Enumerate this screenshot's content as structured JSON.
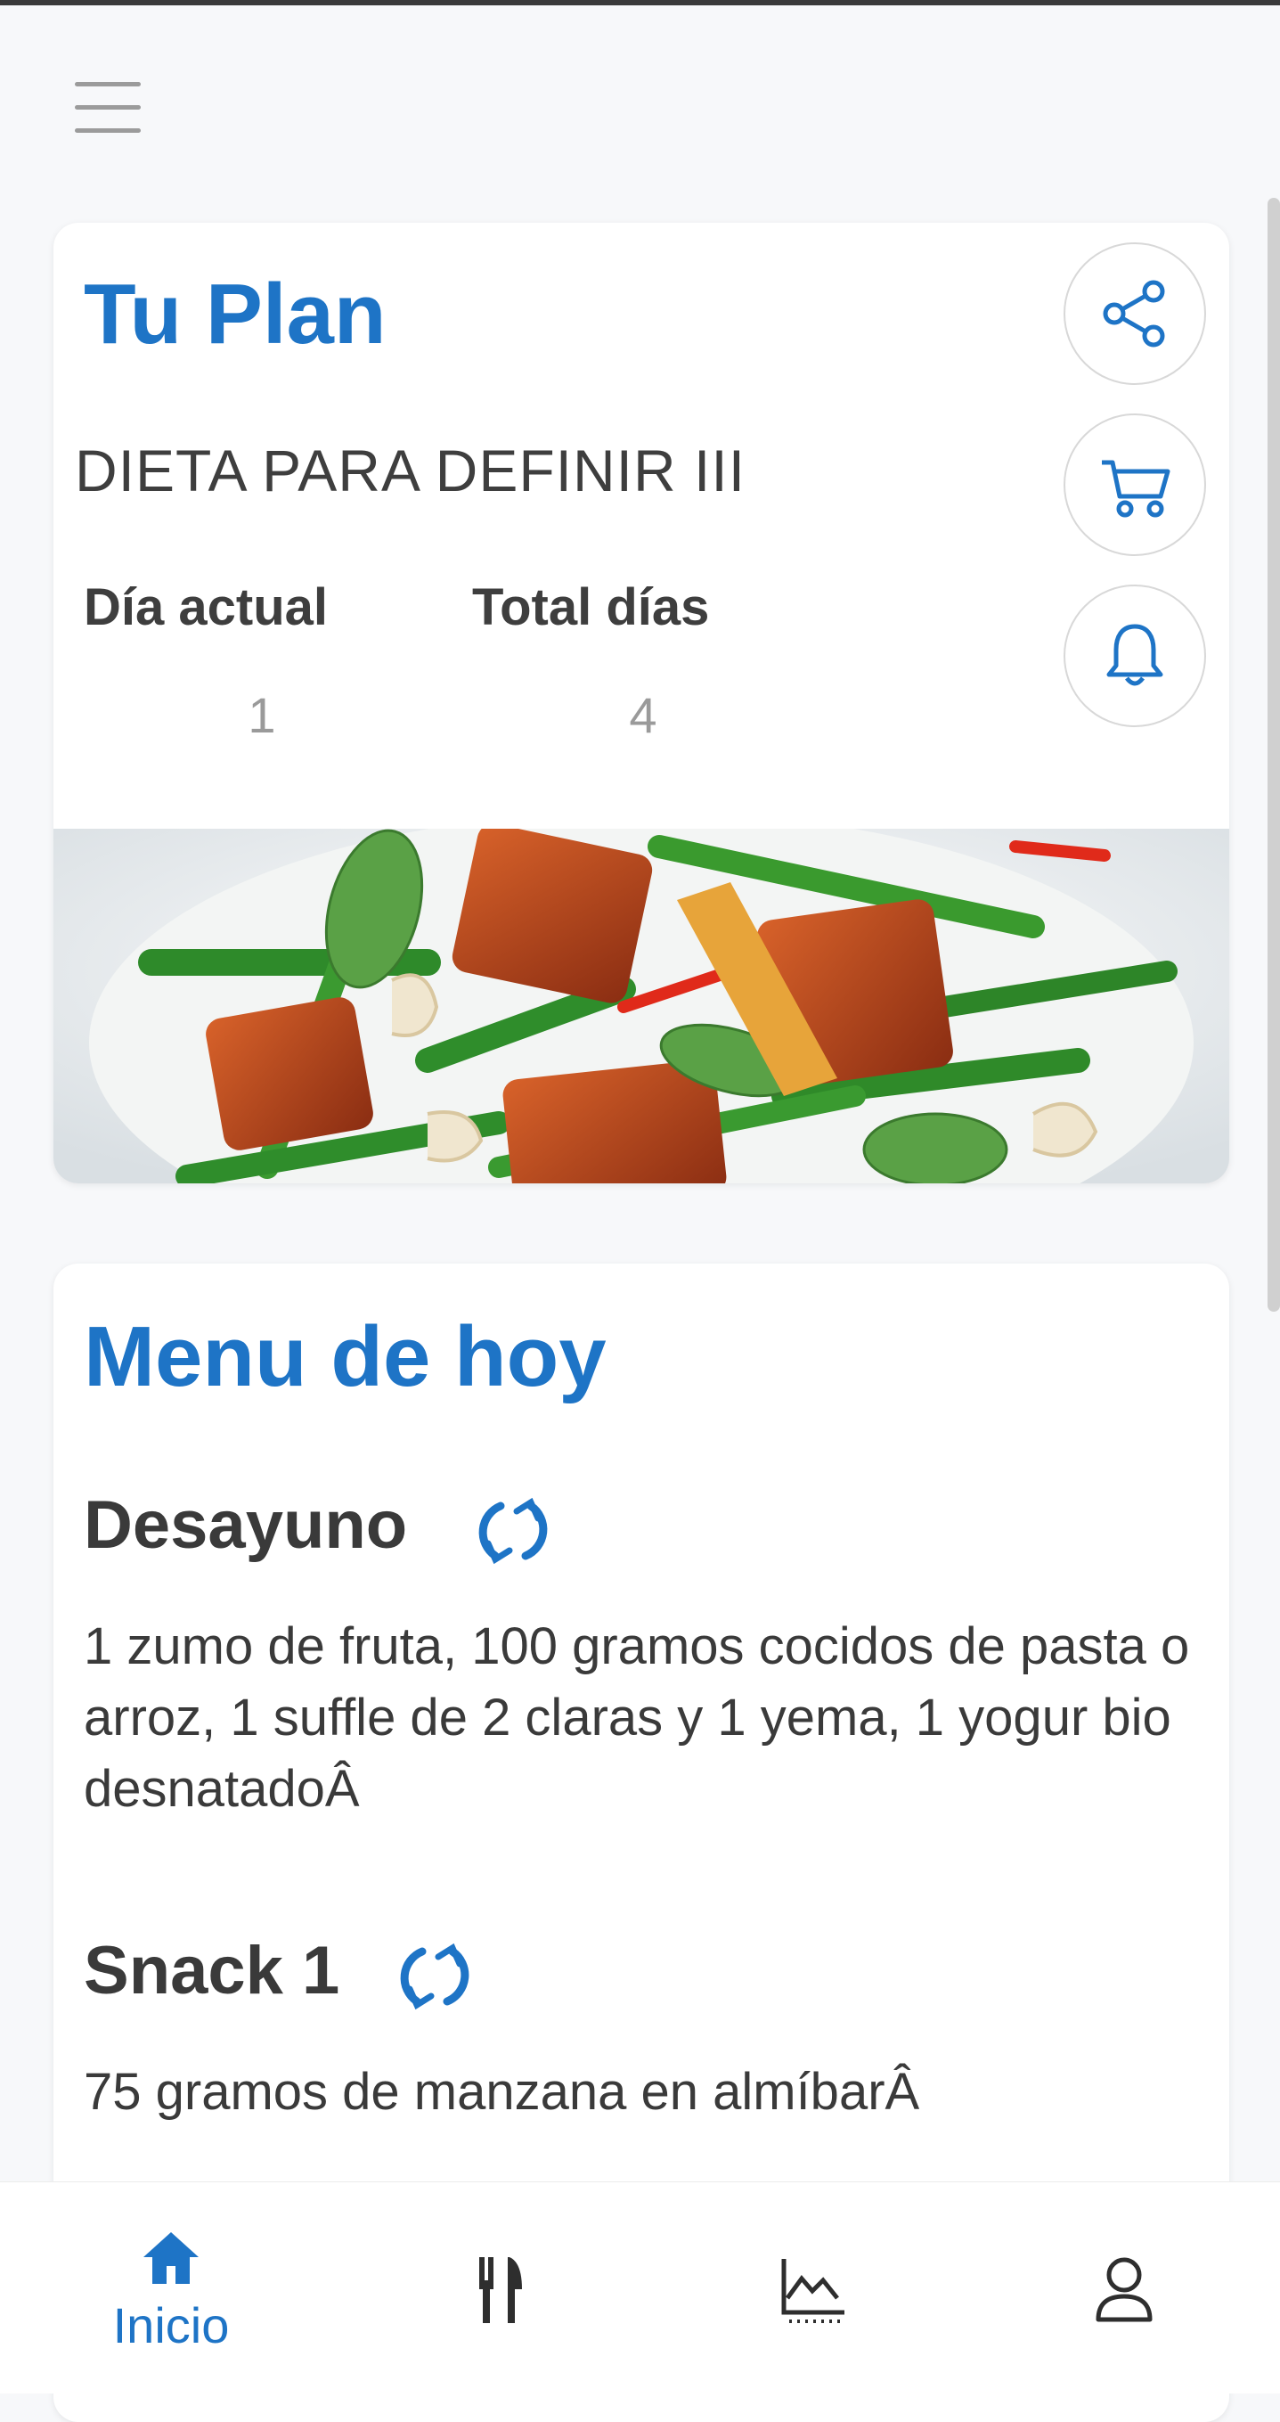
{
  "header": {
    "menu_icon": "hamburger-icon"
  },
  "plan": {
    "title": "Tu Plan",
    "name": "DIETA PARA DEFINIR III",
    "current_day_label": "Día actual",
    "current_day_value": "1",
    "total_days_label": "Total días",
    "total_days_value": "4",
    "actions": [
      "share-icon",
      "cart-icon",
      "bell-icon"
    ]
  },
  "menu": {
    "title": "Menu de hoy",
    "meals": [
      {
        "name": "Desayuno",
        "description": "1 zumo de fruta, 100 gramos cocidos de pasta o arroz, 1 suffle de 2 claras y 1 yema, 1 yogur bio desnatadoÂ"
      },
      {
        "name": "Snack 1",
        "description": "75 gramos de manzana en almíbarÂ"
      }
    ]
  },
  "nav": {
    "items": [
      {
        "label": "Inicio",
        "icon": "home-icon",
        "active": true
      },
      {
        "label": "",
        "icon": "utensils-icon"
      },
      {
        "label": "",
        "icon": "chart-icon"
      },
      {
        "label": "",
        "icon": "user-icon"
      }
    ]
  },
  "colors": {
    "accent": "#1e74c6",
    "text": "#3a3a3a",
    "muted": "#9a9a9a"
  }
}
